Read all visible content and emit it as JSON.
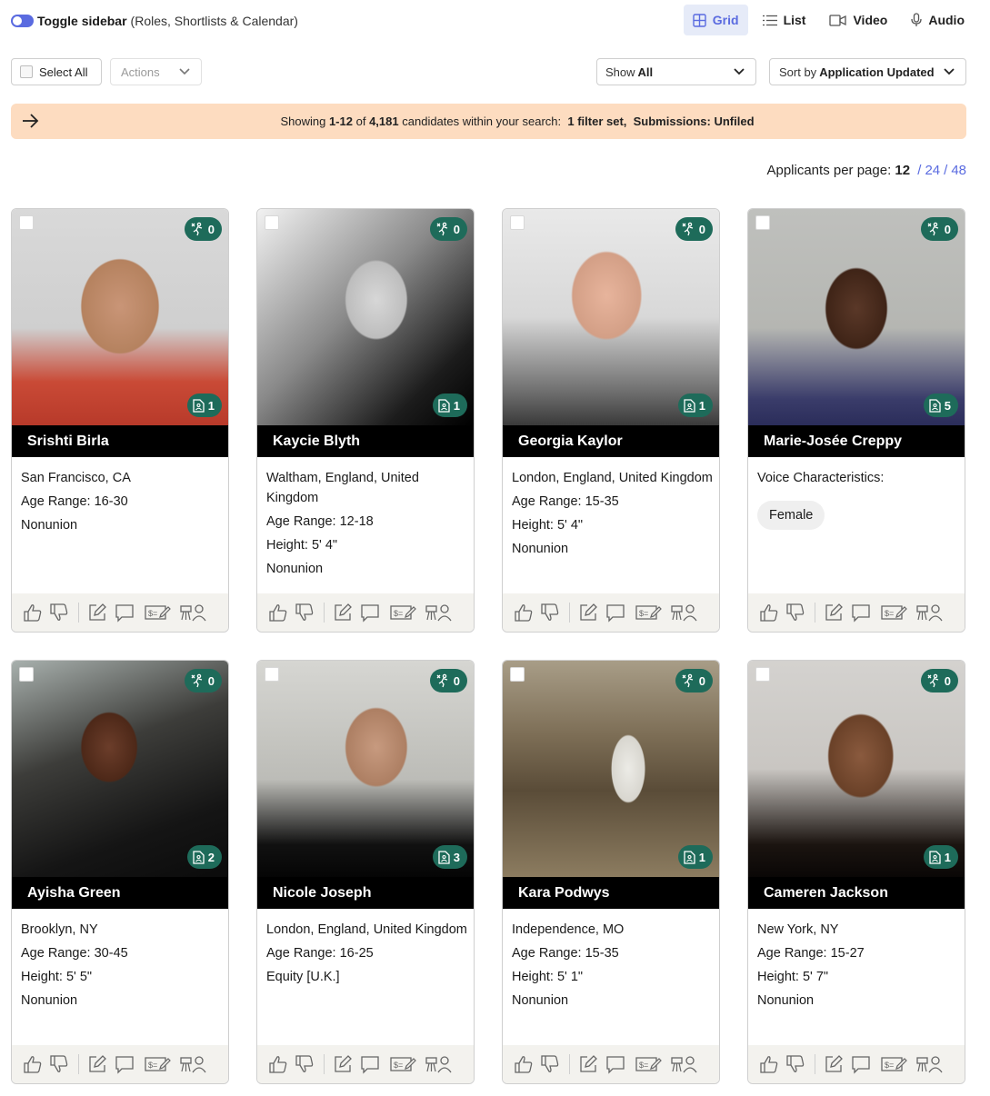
{
  "header": {
    "toggle_label": "Toggle sidebar",
    "toggle_sub": "(Roles, Shortlists & Calendar)",
    "tabs": [
      {
        "label": "Grid",
        "icon": "grid-icon",
        "active": true
      },
      {
        "label": "List",
        "icon": "list-icon",
        "active": false
      },
      {
        "label": "Video",
        "icon": "video-icon",
        "active": false
      },
      {
        "label": "Audio",
        "icon": "microphone-icon",
        "active": false
      }
    ]
  },
  "toolbar": {
    "select_all": "Select All",
    "actions": "Actions",
    "show_prefix": "Show",
    "show_value": "All",
    "sort_prefix": "Sort by",
    "sort_value": "Application Updated"
  },
  "banner": {
    "showing": "Showing",
    "range": "1-12",
    "of": "of",
    "total": "4,181",
    "within": "candidates within your search:",
    "filter": "1 filter set,",
    "submissions": "Submissions: Unfiled"
  },
  "per_page": {
    "label": "Applicants per page:",
    "current": "12",
    "options": [
      "24",
      "48"
    ]
  },
  "colors": {
    "accent": "#5a6be0",
    "badge": "#1e6b5a",
    "banner": "#fddcc0",
    "footer": "#f3f2ee"
  },
  "cards": [
    {
      "name": "Srishti Birla",
      "top_count": "0",
      "bottom_count": "1",
      "lines": [
        "San Francisco, CA",
        "Age Range: 16-30",
        "Nonunion"
      ]
    },
    {
      "name": "Kaycie Blyth",
      "top_count": "0",
      "bottom_count": "1",
      "lines": [
        "Waltham, England, United Kingdom",
        "Age Range: 12-18",
        "Height: 5' 4\"",
        "Nonunion"
      ]
    },
    {
      "name": "Georgia Kaylor",
      "top_count": "0",
      "bottom_count": "1",
      "lines": [
        "London, England, United Kingdom",
        "Age Range: 15-35",
        "Height: 5' 4\"",
        "Nonunion"
      ]
    },
    {
      "name": "Marie-Josée Creppy",
      "top_count": "0",
      "bottom_count": "5",
      "lines": [
        "Voice Characteristics:"
      ],
      "chip": "Female"
    },
    {
      "name": "Ayisha Green",
      "top_count": "0",
      "bottom_count": "2",
      "lines": [
        "Brooklyn, NY",
        "Age Range: 30-45",
        "Height: 5' 5\"",
        "Nonunion"
      ]
    },
    {
      "name": "Nicole Joseph",
      "top_count": "0",
      "bottom_count": "3",
      "lines": [
        "London, England, United Kingdom",
        "Age Range: 16-25",
        "Equity [U.K.]"
      ]
    },
    {
      "name": "Kara Podwys",
      "top_count": "0",
      "bottom_count": "1",
      "lines": [
        "Independence, MO",
        "Age Range: 15-35",
        "Height: 5' 1\"",
        "Nonunion"
      ]
    },
    {
      "name": "Cameren Jackson",
      "top_count": "0",
      "bottom_count": "1",
      "lines": [
        "New York, NY",
        "Age Range: 15-27",
        "Height: 5' 7\"",
        "Nonunion"
      ]
    }
  ]
}
